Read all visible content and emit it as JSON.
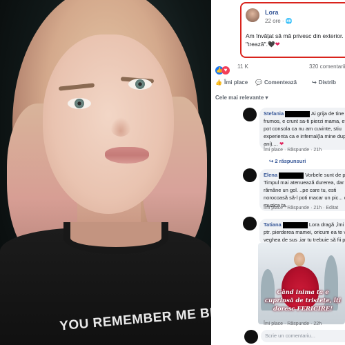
{
  "photo": {
    "shirt_text": "YOU REMEMBER ME BEAUTY"
  },
  "post": {
    "author": "Lora",
    "time": "22 ore ·",
    "text": "Am învățat să mă privesc din exterior. luc",
    "text2": "\"trează\".",
    "hearts": "🖤❤"
  },
  "reactions": {
    "count": "11 K",
    "comments": "320 comentarii"
  },
  "actions": {
    "like": "Îmi place",
    "comment": "Comentează",
    "share": "Distrib"
  },
  "filter": {
    "label": "Cele mai relevante ▾"
  },
  "comments": [
    {
      "name": "Stefania",
      "text": "Ai grija de tine co frumos, e crunt sa-ti pierzi mama, efe te pot consola ca nu am cuvinte, stiu experienta ca e infernal(la mine dupa ani)....",
      "like": "Îmi place",
      "reply": "Răspunde",
      "time": "21h",
      "replies": "↪ 2 răspunsuri"
    },
    {
      "name": "Elena",
      "text": "Vorbele sunt de prisos Timpul mai atenuează durerea, dar v rămâne un gol. ..pe care tu, esti norocoasă să-l poti macar un pic... cu muzica ta.",
      "like": "Îmi place",
      "reply": "Răspunde",
      "time": "21h",
      "edited": "· Editat"
    },
    {
      "name": "Tatiana",
      "text": "Lora dragă ,îmi pare ptr. pierderea mamei, oricum ea te va veghea de sus ,iar tu trebuie să fii pu",
      "like": "Îmi place",
      "reply": "Răspunde",
      "time": "22h"
    }
  ],
  "sticker": {
    "text": "Când inima ta e cuprinsă de tristețe, îți doresc FERICIRE!"
  },
  "input": {
    "placeholder": "Scrie un comentariu..."
  },
  "colors": {
    "link": "#385898",
    "highlight": "#d9231c",
    "like": "#1877f2",
    "love": "#f33e58"
  }
}
